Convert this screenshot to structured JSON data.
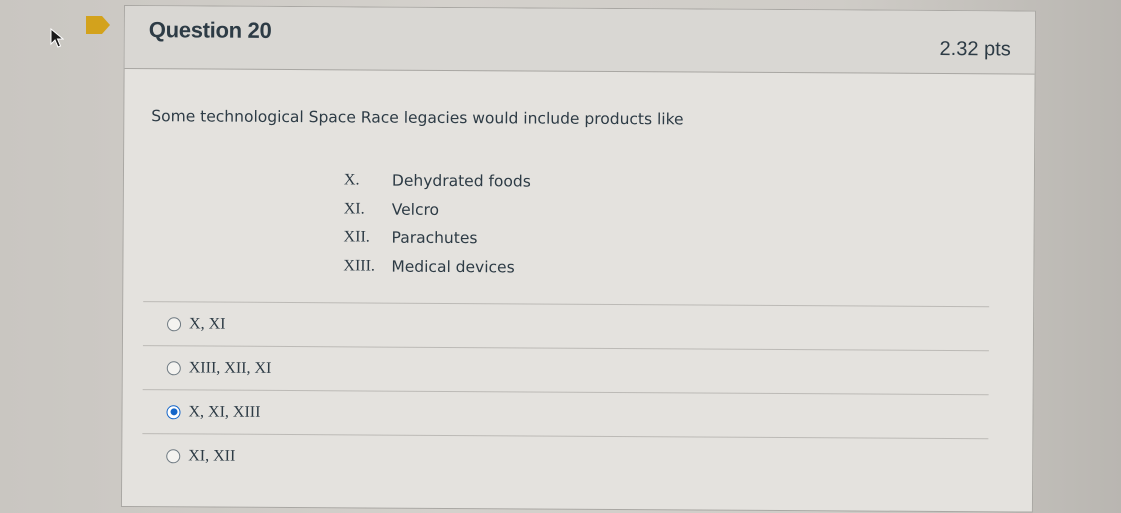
{
  "question": {
    "title": "Question 20",
    "points": "2.32 pts",
    "prompt": "Some technological Space Race legacies would include products like",
    "list": [
      {
        "num": "X.",
        "text": "Dehydrated foods"
      },
      {
        "num": "XI.",
        "text": "Velcro"
      },
      {
        "num": "XII.",
        "text": "Parachutes"
      },
      {
        "num": "XIII.",
        "text": "Medical devices"
      }
    ],
    "answers": [
      {
        "label": "X, XI",
        "selected": false
      },
      {
        "label": "XIII, XII, XI",
        "selected": false
      },
      {
        "label": "X, XI, XIII",
        "selected": true
      },
      {
        "label": "XI, XII",
        "selected": false
      }
    ]
  },
  "colors": {
    "flag": "#d3a21c",
    "radio_selected": "#1566c9",
    "text": "#2d3b45"
  },
  "icons": [
    "pointer-icon",
    "flag-icon",
    "radio-icon"
  ]
}
